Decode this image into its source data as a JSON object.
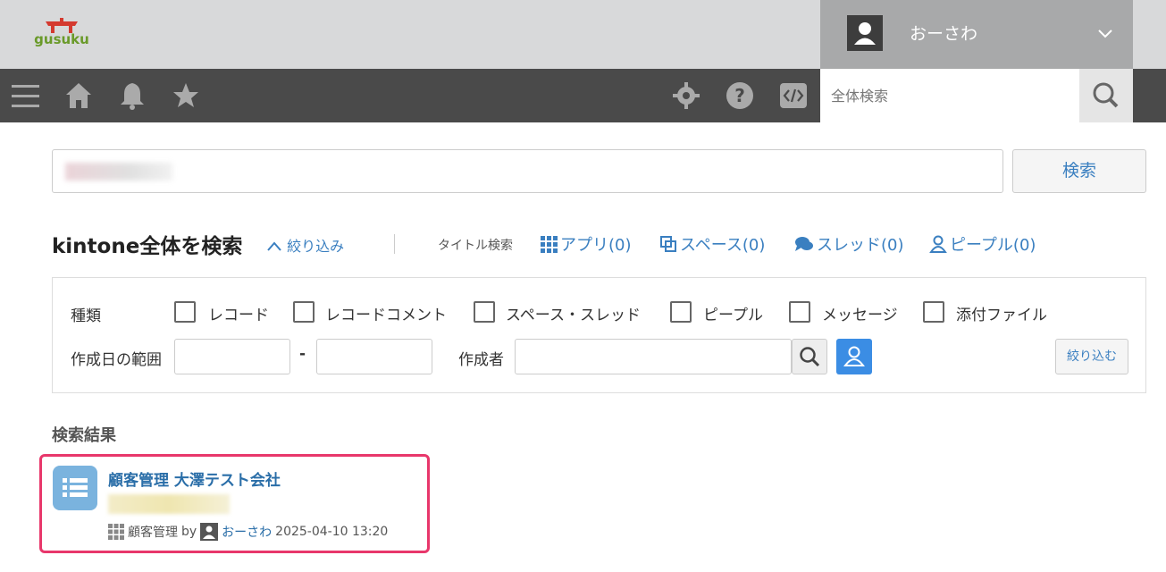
{
  "header": {
    "logo_text": "gusuku",
    "user_name": "おーさわ",
    "global_search_placeholder": "全体検索"
  },
  "search": {
    "button_label": "検索"
  },
  "heading": {
    "title": "kintone全体を検索",
    "filter_toggle": "絞り込み",
    "title_search_label": "タイトル検索"
  },
  "type_links": [
    {
      "label": "アプリ(0)",
      "icon": "app-grid-icon"
    },
    {
      "label": "スペース(0)",
      "icon": "space-icon"
    },
    {
      "label": "スレッド(0)",
      "icon": "thread-icon"
    },
    {
      "label": "ピープル(0)",
      "icon": "people-icon"
    }
  ],
  "filters": {
    "kind_label": "種類",
    "kinds": [
      "レコード",
      "レコードコメント",
      "スペース・スレッド",
      "ピープル",
      "メッセージ",
      "添付ファイル"
    ],
    "date_range_label": "作成日の範囲",
    "date_separator": "-",
    "creator_label": "作成者",
    "narrow_button": "絞り込む"
  },
  "results": {
    "title": "検索結果",
    "items": [
      {
        "title": "顧客管理 大澤テスト会社",
        "app_name": "顧客管理",
        "by": "by",
        "author": "おーさわ",
        "datetime": "2025-04-10 13:20"
      }
    ]
  },
  "colors": {
    "accent": "#3a7fc0",
    "highlight_border": "#e8376b",
    "navbar": "#4a4a4a",
    "topbar": "#d8d9da"
  }
}
